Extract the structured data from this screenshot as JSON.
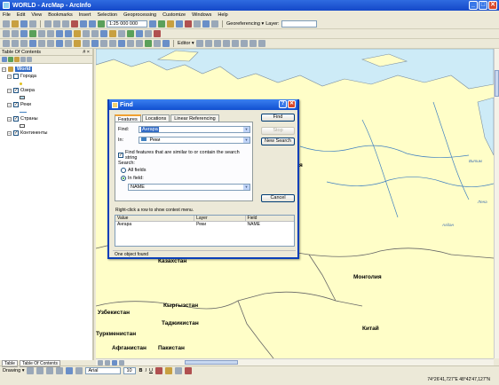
{
  "window": {
    "title": "WORLD - ArcMap - ArcInfo",
    "min": "_",
    "max": "□",
    "close": "✕"
  },
  "menu": [
    "File",
    "Edit",
    "View",
    "Bookmarks",
    "Insert",
    "Selection",
    "Geoprocessing",
    "Customize",
    "Windows",
    "Help"
  ],
  "toolbar": {
    "scale": "1:25 000 000",
    "georef_label": "Georeferencing ▾",
    "layer_label": "Layer:",
    "editor_label": "Editor ▾"
  },
  "toc": {
    "title": "Table Of Contents",
    "pin": "# ×",
    "root": "World",
    "layers": [
      {
        "name": "Города",
        "checked": false
      },
      {
        "name": "Озера",
        "checked": true
      },
      {
        "name": "Реки",
        "checked": true
      },
      {
        "name": "Страны",
        "checked": true
      },
      {
        "name": "Континенты",
        "checked": true
      }
    ],
    "tabs": [
      "Table",
      "Table Of Contents"
    ]
  },
  "map": {
    "countries": [
      {
        "label": "Казахстан"
      },
      {
        "label": "Монголия"
      },
      {
        "label": "Китай"
      },
      {
        "label": "Узбекистан"
      },
      {
        "label": "Кыргызстан"
      },
      {
        "label": "Туркменистан"
      },
      {
        "label": "Таджикистан"
      },
      {
        "label": "Афганистан"
      },
      {
        "label": "Пакистан"
      }
    ],
    "partial_label": "я",
    "rivers": [
      {
        "label": "Витим"
      },
      {
        "label": "Лена"
      },
      {
        "label": "Алдан"
      }
    ]
  },
  "find_dialog": {
    "title": "Find",
    "help": "?",
    "close": "✕",
    "tabs": [
      "Features",
      "Locations",
      "Linear Referencing"
    ],
    "find_label": "Find:",
    "find_value": "Ангара",
    "in_label": "In:",
    "in_value": "Реки",
    "similar_checkbox": "Find features that are similar to or contain the search string",
    "search_label": "Search:",
    "all_fields": "All fields",
    "in_field": "In field:",
    "field_value": "NAME",
    "buttons": {
      "find": "Find",
      "stop": "Stop",
      "new_search": "New Search",
      "cancel": "Cancel"
    },
    "hint": "Right-click a row to show context menu.",
    "results": {
      "columns": [
        "Value",
        "Layer",
        "Field"
      ],
      "rows": [
        [
          "Ангара",
          "Реки",
          "NAME"
        ]
      ]
    },
    "status": "One object found"
  },
  "drawing": {
    "label": "Drawing ▾",
    "font": "Arial",
    "size": "10",
    "bold": "B",
    "italic": "I",
    "underline": "U"
  },
  "status": {
    "coords": "74°26'41,727\"E  48°42'47,127\"N"
  },
  "colors": {
    "title_blue": "#1448c8",
    "map_land": "#fffec8",
    "sea": "#cdebf7"
  }
}
